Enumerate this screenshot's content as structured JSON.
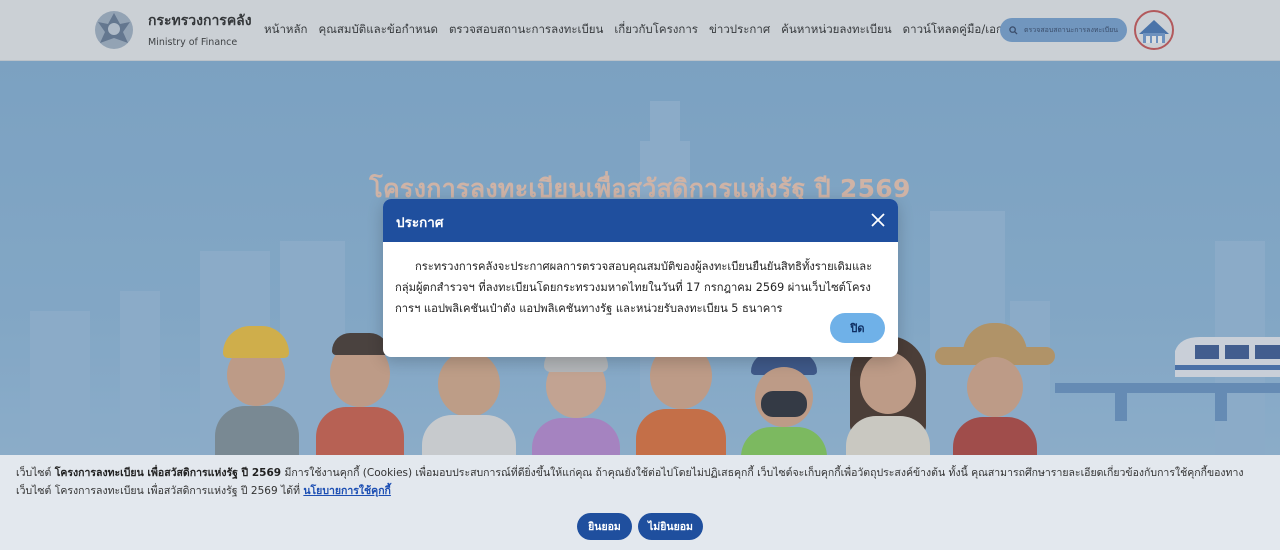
{
  "header": {
    "brand_th": "กระทรวงการคลัง",
    "brand_en": "Ministry of Finance",
    "nav": [
      {
        "label": "หน้าหลัก"
      },
      {
        "label": "คุณสมบัติและข้อกำหนด"
      },
      {
        "label": "ตรวจสอบสถานะการลงทะเบียน"
      },
      {
        "label": "เกี่ยวกับโครงการ"
      },
      {
        "label": "ข่าวประกาศ"
      },
      {
        "label": "ค้นหาหน่วยลงทะเบียน"
      },
      {
        "label": "ดาวน์โหลดคู่มือ/เอกสาร"
      }
    ],
    "search_label": "ตรวจสอบสถานะการลงทะเบียน"
  },
  "hero": {
    "title": "โครงการลงทะเบียนเพื่อสวัสดิการแห่งรัฐ ปี 2569"
  },
  "modal": {
    "title": "ประกาศ",
    "body": "กระทรวงการคลังจะประกาศผลการตรวจสอบคุณสมบัติของผู้ลงทะเบียนยืนยันสิทธิทั้งรายเดิมและกลุ่มผู้ตกสำรวจฯ ที่ลงทะเบียนโดยกระทรวงมหาดไทยในวันที่ 17 กรกฎาคม 2569 ผ่านเว็บไซต์โครงการฯ แอปพลิเคชันเป๋าตัง แอปพลิเคชันทางรัฐ และหน่วยรับลงทะเบียน 5 ธนาคาร",
    "close_label": "ปิด"
  },
  "cookie": {
    "prefix": "เว็บไซต์ ",
    "site_name": "โครงการลงทะเบียน เพื่อสวัสดิการแห่งรัฐ ปี 2569",
    "body": " มีการใช้งานคุกกี้ (Cookies) เพื่อมอบประสบการณ์ที่ดียิ่งขึ้นให้แก่คุณ ถ้าคุณยังใช้ต่อไปโดยไม่ปฏิเสธคุกกี้ เว็บไซต์จะเก็บคุกกี้เพื่อวัตถุประสงค์ข้างต้น ทั้งนี้ คุณสามารถศึกษารายละเอียดเกี่ยวข้องกับการใช้คุกกี้ของทางเว็บไซต์ โครงการลงทะเบียน เพื่อสวัสดิการแห่งรัฐ ปี 2569 ได้ที่ ",
    "policy_link": "นโยบายการใช้คุกกี้",
    "accept_label": "ยินยอม",
    "decline_label": "ไม่ยินยอม"
  },
  "colors": {
    "primary": "#1f4f9e",
    "accent": "#6fb1e8",
    "hero_bg": "#88b6dc"
  }
}
